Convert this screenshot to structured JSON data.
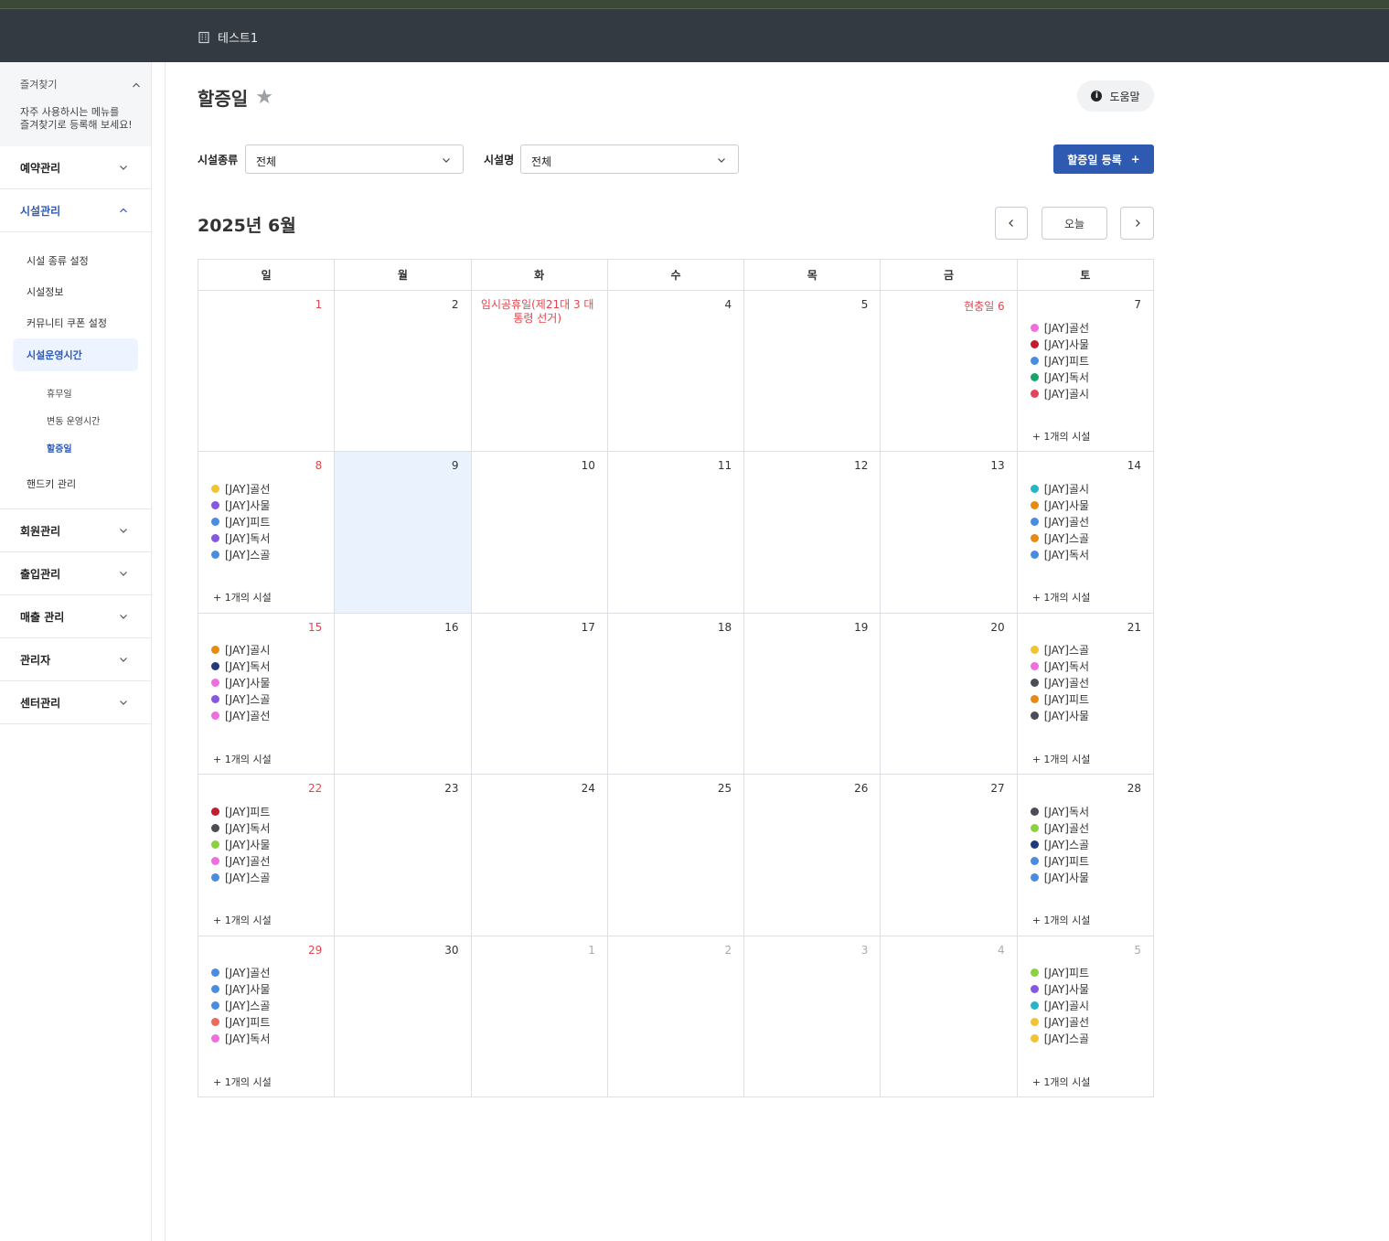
{
  "header": {
    "center_name": "테스트1"
  },
  "sidebar": {
    "favorites_title": "즐겨찾기",
    "favorites_desc": "자주 사용하시는 메뉴를\n즐겨찾기로 등록해 보세요!",
    "menus": [
      {
        "label": "예약관리"
      },
      {
        "label": "시설관리"
      },
      {
        "label": "회원관리"
      },
      {
        "label": "출입관리"
      },
      {
        "label": "매출 관리"
      },
      {
        "label": "관리자"
      },
      {
        "label": "센터관리"
      }
    ],
    "facility_sub": [
      "시설 종류 설정",
      "시설정보",
      "커뮤니티 쿠폰 설정",
      "시설운영시간",
      "핸드키 관리"
    ],
    "operation_sub": [
      "휴무일",
      "변동 운영시간",
      "할증일"
    ]
  },
  "page": {
    "title": "할증일",
    "help_label": "도움말"
  },
  "filters": {
    "type_label": "시설종류",
    "type_value": "전체",
    "name_label": "시설명",
    "name_value": "전체",
    "register_label": "할증일 등록"
  },
  "calendar": {
    "month_label": "2025년 6월",
    "today_label": "오늘",
    "weekdays": [
      "일",
      "월",
      "화",
      "수",
      "목",
      "금",
      "토"
    ],
    "more_label": "+ 1개의 시설",
    "weeks": [
      [
        {
          "day": "1",
          "red": true,
          "events": []
        },
        {
          "day": "2",
          "events": []
        },
        {
          "day": "",
          "holiday_center": "임시공휴일(제21대 3 대통령 선거)",
          "events": []
        },
        {
          "day": "4",
          "events": []
        },
        {
          "day": "5",
          "events": []
        },
        {
          "day": "",
          "holiday_right": "현충일 6",
          "events": []
        },
        {
          "day": "7",
          "more": true,
          "events": [
            {
              "name": "[JAY]골선",
              "color": "#f06de0"
            },
            {
              "name": "[JAY]사물",
              "color": "#c21d2e"
            },
            {
              "name": "[JAY]피트",
              "color": "#4a8de0"
            },
            {
              "name": "[JAY]독서",
              "color": "#16a56b"
            },
            {
              "name": "[JAY]골시",
              "color": "#e4445a"
            }
          ]
        }
      ],
      [
        {
          "day": "8",
          "red": true,
          "more": true,
          "events": [
            {
              "name": "[JAY]골선",
              "color": "#f1c232"
            },
            {
              "name": "[JAY]사물",
              "color": "#8658e0"
            },
            {
              "name": "[JAY]피트",
              "color": "#4a8de0"
            },
            {
              "name": "[JAY]독서",
              "color": "#8658e0"
            },
            {
              "name": "[JAY]스골",
              "color": "#4a8de0"
            }
          ]
        },
        {
          "day": "9",
          "today": true,
          "events": []
        },
        {
          "day": "10",
          "events": []
        },
        {
          "day": "11",
          "events": []
        },
        {
          "day": "12",
          "events": []
        },
        {
          "day": "13",
          "events": []
        },
        {
          "day": "14",
          "more": true,
          "events": [
            {
              "name": "[JAY]골시",
              "color": "#26b4c9"
            },
            {
              "name": "[JAY]사물",
              "color": "#e88a12"
            },
            {
              "name": "[JAY]골선",
              "color": "#4a8de0"
            },
            {
              "name": "[JAY]스골",
              "color": "#e88a12"
            },
            {
              "name": "[JAY]독서",
              "color": "#4a8de0"
            }
          ]
        }
      ],
      [
        {
          "day": "15",
          "red": true,
          "more": true,
          "events": [
            {
              "name": "[JAY]골시",
              "color": "#e88a12"
            },
            {
              "name": "[JAY]독서",
              "color": "#233a7a"
            },
            {
              "name": "[JAY]사물",
              "color": "#f06de0"
            },
            {
              "name": "[JAY]스골",
              "color": "#8658e0"
            },
            {
              "name": "[JAY]골선",
              "color": "#f06de0"
            }
          ]
        },
        {
          "day": "16",
          "events": []
        },
        {
          "day": "17",
          "events": []
        },
        {
          "day": "18",
          "events": []
        },
        {
          "day": "19",
          "events": []
        },
        {
          "day": "20",
          "events": []
        },
        {
          "day": "21",
          "more": true,
          "events": [
            {
              "name": "[JAY]스골",
              "color": "#f1c232"
            },
            {
              "name": "[JAY]독서",
              "color": "#f06de0"
            },
            {
              "name": "[JAY]골선",
              "color": "#4a4d54"
            },
            {
              "name": "[JAY]피트",
              "color": "#e88a12"
            },
            {
              "name": "[JAY]사물",
              "color": "#4a4d54"
            }
          ]
        }
      ],
      [
        {
          "day": "22",
          "red": true,
          "more": true,
          "events": [
            {
              "name": "[JAY]피트",
              "color": "#c21d2e"
            },
            {
              "name": "[JAY]독서",
              "color": "#4a4d54"
            },
            {
              "name": "[JAY]사물",
              "color": "#8cd13e"
            },
            {
              "name": "[JAY]골선",
              "color": "#f06de0"
            },
            {
              "name": "[JAY]스골",
              "color": "#4a8de0"
            }
          ]
        },
        {
          "day": "23",
          "events": []
        },
        {
          "day": "24",
          "events": []
        },
        {
          "day": "25",
          "events": []
        },
        {
          "day": "26",
          "events": []
        },
        {
          "day": "27",
          "events": []
        },
        {
          "day": "28",
          "more": true,
          "events": [
            {
              "name": "[JAY]독서",
              "color": "#4a4d54"
            },
            {
              "name": "[JAY]골선",
              "color": "#8cd13e"
            },
            {
              "name": "[JAY]스골",
              "color": "#233a7a"
            },
            {
              "name": "[JAY]피트",
              "color": "#4a8de0"
            },
            {
              "name": "[JAY]사물",
              "color": "#4a8de0"
            }
          ]
        }
      ],
      [
        {
          "day": "29",
          "red": true,
          "more": true,
          "events": [
            {
              "name": "[JAY]골선",
              "color": "#4a8de0"
            },
            {
              "name": "[JAY]사물",
              "color": "#4a8de0"
            },
            {
              "name": "[JAY]스골",
              "color": "#4a8de0"
            },
            {
              "name": "[JAY]피트",
              "color": "#ea6a5c"
            },
            {
              "name": "[JAY]독서",
              "color": "#f06de0"
            }
          ]
        },
        {
          "day": "30",
          "events": []
        },
        {
          "day": "1",
          "muted": true,
          "events": []
        },
        {
          "day": "2",
          "muted": true,
          "events": []
        },
        {
          "day": "3",
          "muted": true,
          "events": []
        },
        {
          "day": "4",
          "muted": true,
          "events": []
        },
        {
          "day": "5",
          "muted": true,
          "more": true,
          "events": [
            {
              "name": "[JAY]피트",
              "color": "#8cd13e"
            },
            {
              "name": "[JAY]사물",
              "color": "#8658e0"
            },
            {
              "name": "[JAY]골시",
              "color": "#26b4c9"
            },
            {
              "name": "[JAY]골선",
              "color": "#f1c232"
            },
            {
              "name": "[JAY]스골",
              "color": "#f1c232"
            }
          ]
        }
      ]
    ]
  }
}
